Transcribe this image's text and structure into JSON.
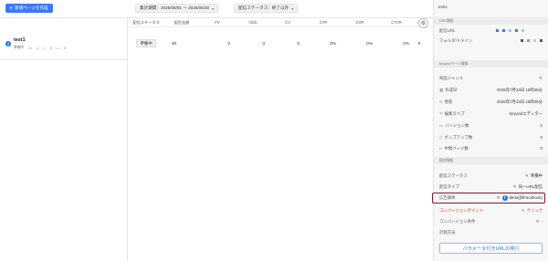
{
  "toolbar": {
    "create_button": "新規ページを作成",
    "period_label": "集計期間：2025/06/01 〜 2025/06/30",
    "status_filter": "配信ステータス：終了以外"
  },
  "table": {
    "headers": [
      "配信ステータス",
      "配信金額",
      "PV",
      "Click",
      "CV",
      "CTR",
      "CVR",
      "CTVR",
      "C"
    ],
    "row": [
      "準備中",
      "¥0",
      "0",
      "0",
      "0",
      "0%",
      "0%",
      "0%",
      "¥"
    ]
  },
  "page_item": {
    "name": "test1",
    "status": "準備中",
    "counts": [
      "1",
      "0",
      "0"
    ]
  },
  "right_panel": {
    "title": "test1",
    "url_section": "URL情報",
    "url_label": "配信URL",
    "folder_label": "フォルダ/ドメイン",
    "beyond_section": "beyondページ情報",
    "genre_label": "商品ジャンル",
    "created_label": "作成日",
    "created_value": "2025年7月23日 15時25分",
    "updated_label": "更新",
    "updated_value": "2025年7月23日 15時29分",
    "edit_type_label": "編集タイプ",
    "edit_type_value": "beyondエディター",
    "version_label": "バージョン数",
    "version_value": "1",
    "popup_label": "ポップアップ数",
    "popup_value": "0",
    "midpage_label": "中間ページ数",
    "midpage_value": "0",
    "delivery_section": "配信情報",
    "status_label": "配信ステータス",
    "status_value": "準備中",
    "type_label": "配信タイプ",
    "type_value": "同一URL配信",
    "media_label": "広告媒体",
    "media_value": "Meta(旧Facebook)",
    "conversion_label": "コンバージョンポイント",
    "conversion_value": "クリック",
    "condition_label": "コンバージョン条件",
    "condition_value": "-",
    "measure_label": "計測方法",
    "url_button": "パラメータ付きURLの発行"
  },
  "colors": {
    "accent": "#3b76ff",
    "facebook": "#1877f2",
    "highlight": "#7a1a3a",
    "warning": "#e0342b"
  }
}
